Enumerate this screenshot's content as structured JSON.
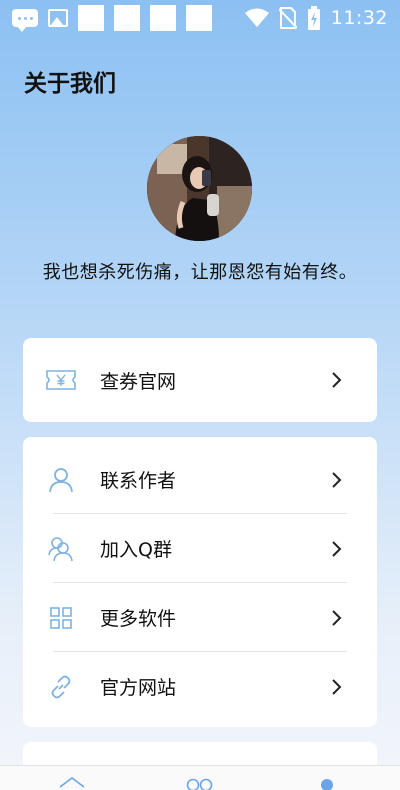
{
  "status_bar": {
    "time": "11:32"
  },
  "page": {
    "title": "关于我们",
    "motto": "我也想杀死伤痛，让那恩怨有始有终。"
  },
  "coupon_card": {
    "label": "查券官网",
    "icon": "ticket-yen-icon"
  },
  "menu_card": {
    "items": [
      {
        "label": "联系作者",
        "icon": "person-icon"
      },
      {
        "label": "加入Q群",
        "icon": "group-icon"
      },
      {
        "label": "更多软件",
        "icon": "grid-icon"
      },
      {
        "label": "官方网站",
        "icon": "link-icon"
      }
    ]
  },
  "colors": {
    "accent": "#7fb2df",
    "background_top": "#8cc0f2",
    "nav_active": "#6aa6e6"
  }
}
